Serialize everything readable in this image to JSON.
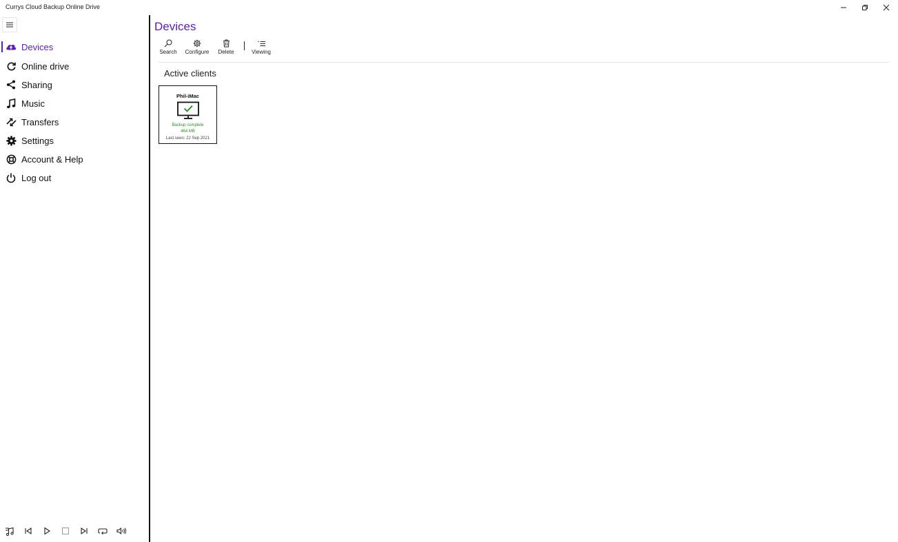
{
  "window": {
    "title": "Currys Cloud Backup Online Drive",
    "controls": [
      "minimize-icon",
      "restore-icon",
      "close-icon"
    ]
  },
  "sidebar": {
    "menu_icon": "hamburger-icon",
    "items": [
      {
        "label": "Devices",
        "icon": "cloud-upload-icon",
        "active": true
      },
      {
        "label": "Online drive",
        "icon": "sync-icon",
        "active": false
      },
      {
        "label": "Sharing",
        "icon": "share-icon",
        "active": false
      },
      {
        "label": "Music",
        "icon": "music-note-icon",
        "active": false
      },
      {
        "label": "Transfers",
        "icon": "transfer-icon",
        "active": false
      },
      {
        "label": "Settings",
        "icon": "gear-icon",
        "active": false
      },
      {
        "label": "Account & Help",
        "icon": "lifebuoy-icon",
        "active": false
      },
      {
        "label": "Log out",
        "icon": "power-icon",
        "active": false
      }
    ],
    "player_controls": [
      "music-list-icon",
      "previous-icon",
      "play-icon",
      "stop-icon",
      "next-icon",
      "repeat-icon",
      "volume-icon"
    ]
  },
  "main": {
    "title": "Devices",
    "toolbar": {
      "search": "Search",
      "configure": "Configure",
      "delete": "Delete",
      "viewing": "Viewing"
    },
    "section_title": "Active clients",
    "devices": [
      {
        "name": "Phil-iMac",
        "icon": "monitor-check-icon",
        "status": "Backup complete",
        "size": "464 MB",
        "last_seen": "Last seen: 22 Sep 2021"
      }
    ]
  },
  "colors": {
    "accent": "#5a21b2",
    "status_ok": "#2e8b2e",
    "divider": "#111111"
  }
}
